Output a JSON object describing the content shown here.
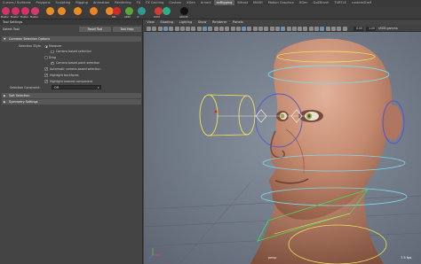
{
  "shelf": {
    "tabs": [
      "Curves / Surfaces",
      "Polygons",
      "Sculpting",
      "Rigging",
      "Animation",
      "Rendering",
      "FX",
      "FX Caching",
      "Custom",
      "XGen",
      "Arnold",
      "xxRigging",
      "Bifrost",
      "MASH",
      "Motion Graphics",
      "XGen",
      "GoZBrush",
      "TURTLE",
      "customShelf"
    ],
    "active_tab_index": 11,
    "icons": [
      {
        "label": "Master",
        "color": "#d0346a"
      },
      {
        "label": "Master",
        "color": "#cf3169"
      },
      {
        "label": "Master",
        "color": "#d33168"
      },
      {
        "label": "Master",
        "color": "#d23a6a"
      },
      {
        "label": "",
        "color": "#eb8f25"
      },
      {
        "label": "",
        "color": "#e98a24"
      },
      {
        "label": "",
        "color": "#eb8d20"
      },
      {
        "label": "",
        "color": "#e9861f"
      },
      {
        "label": "",
        "color": "#ec8a26"
      },
      {
        "label": "SEL",
        "color": "#d42a2a"
      },
      {
        "label": "ANIM",
        "color": "#5aa638"
      },
      {
        "label": "LT",
        "color": "#2e9c8c"
      },
      {
        "label": "SHOT",
        "color": "#d13d33"
      },
      {
        "label": "",
        "color": "#29b28a"
      },
      {
        "label": "GROUP",
        "color": "#111111"
      }
    ]
  },
  "tool_settings": {
    "title": "Tool Settings",
    "tool_name": "Select Tool",
    "reset_label": "Reset Tool",
    "help_label": "Tool Help",
    "common_header": "Common Selection Options",
    "selection_style_label": "Selection Style:",
    "marquee_label": "Marquee",
    "camera_marquee_label": "Camera based selection",
    "drag_label": "Drag",
    "camera_paint_label": "Camera based paint selection",
    "auto_backfaces_label": "Automatic camera-based selection",
    "highlight_backfaces_label": "Highlight backfaces",
    "highlight_nearest_label": "Highlight nearest component",
    "constraint_label": "Selection Constraint:",
    "constraint_value": "Off",
    "soft_header": "Soft Selection",
    "symmetry_header": "Symmetry Settings"
  },
  "viewport": {
    "menus": [
      "View",
      "Shading",
      "Lighting",
      "Show",
      "Renderer",
      "Panels"
    ],
    "field_a": "0.00",
    "field_b": "1.00",
    "color_space": "sRGB gamma",
    "camera_label": "persp",
    "fps": "7.5 fps",
    "colors": {
      "skin": "#c98f74",
      "background": "#6e7783",
      "ctrl_yellow": "#f0e25a",
      "ctrl_cyan": "#7fd8e8",
      "ctrl_blue": "#5a58c8",
      "ctrl_green": "#4fd15a"
    }
  }
}
